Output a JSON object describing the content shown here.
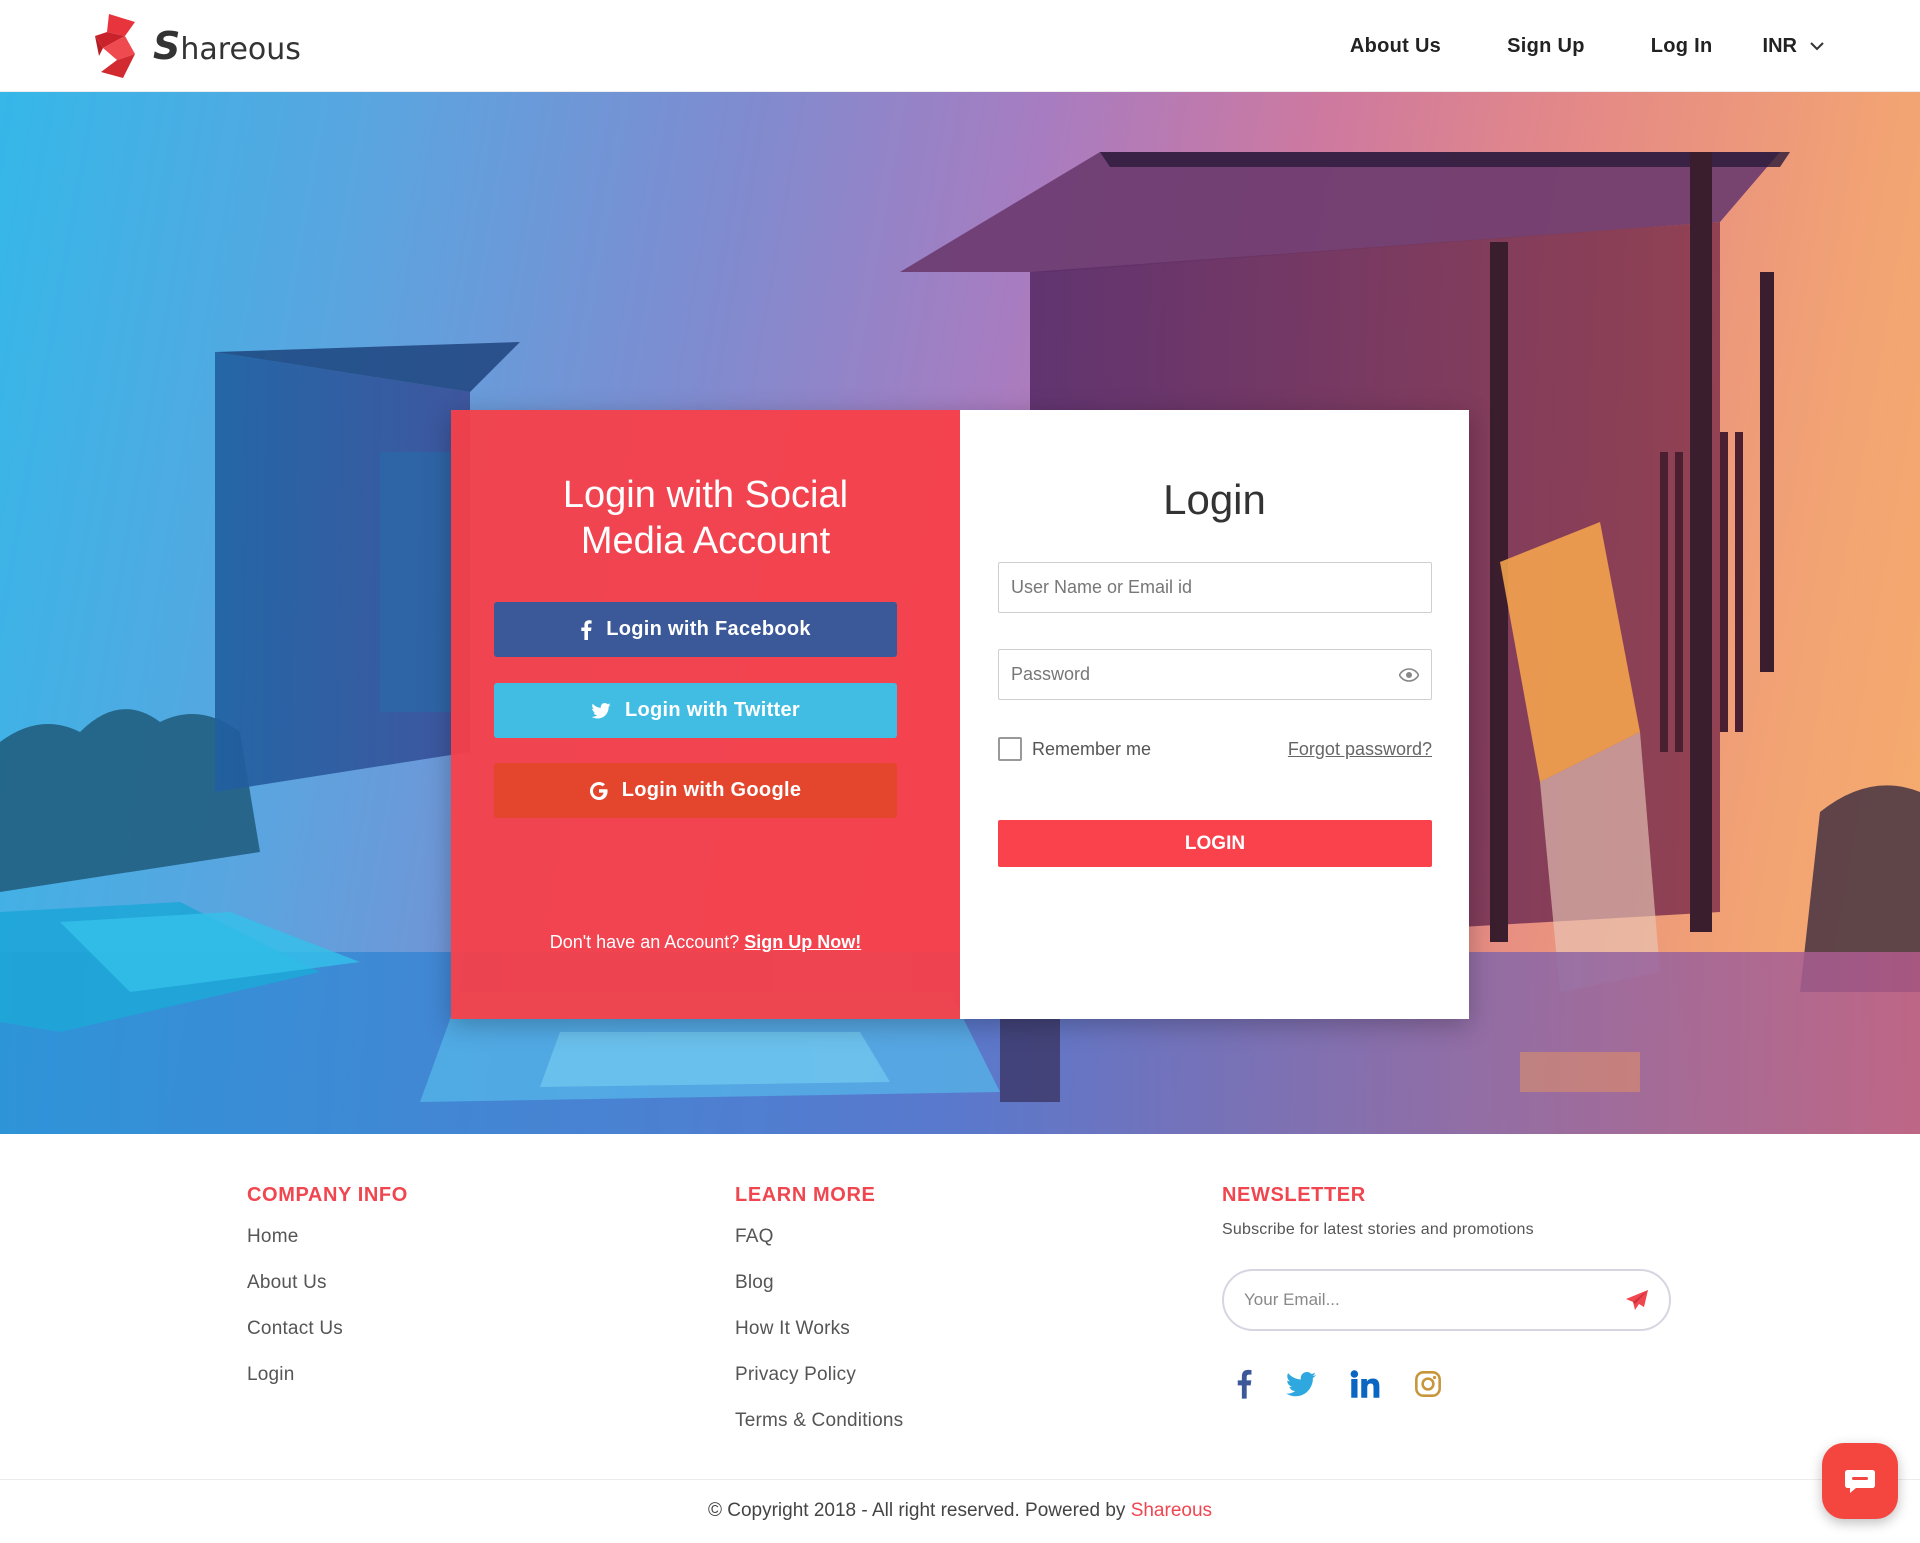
{
  "header": {
    "logo_text": "hareous",
    "logo_letter": "S",
    "nav": [
      "About Us",
      "Sign Up",
      "Log In"
    ],
    "currency": "INR"
  },
  "social": {
    "title_line1": "Login with Social",
    "title_line2": "Media Account",
    "facebook": "Login with Facebook",
    "twitter": "Login with Twitter",
    "google": "Login with Google",
    "no_account": "Don't have an Account?",
    "signup_link": "Sign Up Now!"
  },
  "login": {
    "title": "Login",
    "username_placeholder": "User Name or Email id",
    "password_placeholder": "Password",
    "remember": "Remember me",
    "forgot": "Forgot password?",
    "button": "LOGIN"
  },
  "footer": {
    "company": {
      "heading": "COMPANY INFO",
      "links": [
        "Home",
        "About Us",
        "Contact Us",
        "Login"
      ]
    },
    "learn": {
      "heading": "LEARN MORE",
      "links": [
        "FAQ",
        "Blog",
        "How It Works",
        "Privacy Policy",
        "Terms & Conditions"
      ]
    },
    "newsletter": {
      "heading": "NEWSLETTER",
      "subtitle": "Subscribe for latest stories and promotions",
      "email_placeholder": "Your Email..."
    },
    "social_icons": [
      "facebook-icon",
      "twitter-icon",
      "linkedin-icon",
      "instagram-icon"
    ],
    "copyright_prefix": "© Copyright 2018 - All right reserved. Powered by",
    "copyright_brand": "Shareous"
  },
  "colors": {
    "brand_red": "#f9424c",
    "facebook": "#3b5998",
    "twitter": "#41bde3",
    "google": "#e3452d"
  }
}
